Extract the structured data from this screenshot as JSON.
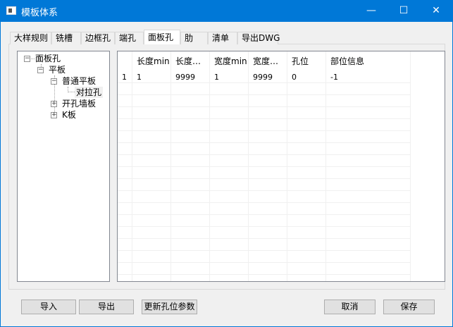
{
  "window": {
    "title": "模板体系",
    "minimize": "—",
    "maximize": "☐",
    "close": "✕"
  },
  "tabs": [
    "大样规则",
    "铣槽",
    "边框孔",
    "端孔",
    "面板孔",
    "肋",
    "清单",
    "导出DWG"
  ],
  "selected_tab": "面板孔",
  "tree": {
    "root": "面板孔",
    "child": "平板",
    "grandchild": "普通平板",
    "leaf": "对拉孔",
    "sibling1": "开孔墙板",
    "sibling2": "K板"
  },
  "table": {
    "headers": [
      "长度min",
      "长度…",
      "宽度min",
      "宽度…",
      "孔位",
      "部位信息"
    ],
    "rows": [
      {
        "index": "1",
        "cells": [
          "1",
          "9999",
          "1",
          "9999",
          "0",
          "-1"
        ]
      }
    ]
  },
  "buttons": {
    "import": "导入",
    "export": "导出",
    "update": "更新孔位参数",
    "cancel": "取消",
    "save": "保存"
  }
}
